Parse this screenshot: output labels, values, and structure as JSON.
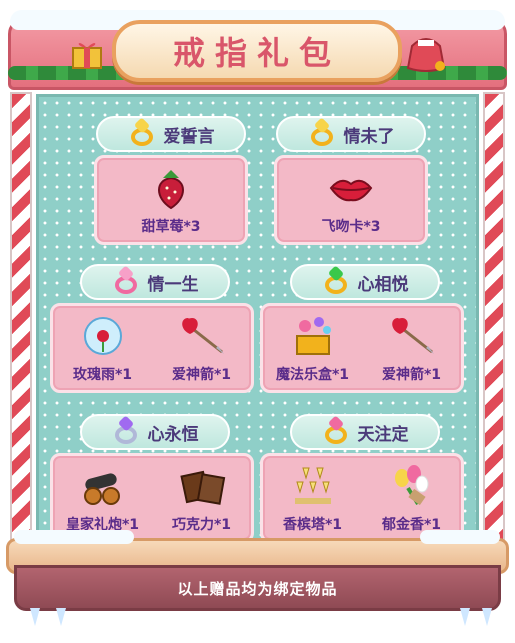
{
  "title": "戒指礼包",
  "footer": "以上赠品均为绑定物品",
  "colors": {
    "label_purple": "#5a2c8a",
    "card_pink": "#f3b9c7",
    "panel_teal": "#8fcfc8",
    "gold": "#f2b21c"
  },
  "packs": [
    {
      "name": "爱誓言",
      "ring_icon": "gold-ring-icon",
      "items": [
        {
          "label": "甜草莓*3",
          "icon": "strawberry-icon"
        }
      ]
    },
    {
      "name": "情未了",
      "ring_icon": "vip-ring-icon",
      "items": [
        {
          "label": "飞吻卡*3",
          "icon": "lips-icon"
        }
      ]
    },
    {
      "name": "情一生",
      "ring_icon": "pink-ring-icon",
      "items": [
        {
          "label": "玫瑰雨*1",
          "icon": "rose-globe-icon"
        },
        {
          "label": "爱神箭*1",
          "icon": "cupid-arrow-icon"
        }
      ]
    },
    {
      "name": "心相悦",
      "ring_icon": "emerald-ring-icon",
      "items": [
        {
          "label": "魔法乐盒*1",
          "icon": "music-box-icon"
        },
        {
          "label": "爱神箭*1",
          "icon": "cupid-arrow-icon"
        }
      ]
    },
    {
      "name": "心永恒",
      "ring_icon": "heart-ring-icon",
      "items": [
        {
          "label": "皇家礼炮*1",
          "icon": "cannon-icon"
        },
        {
          "label": "巧克力*1",
          "icon": "chocolate-icon"
        }
      ]
    },
    {
      "name": "天注定",
      "ring_icon": "vip-heart-ring-icon",
      "items": [
        {
          "label": "香槟塔*1",
          "icon": "champagne-tower-icon"
        },
        {
          "label": "郁金香*1",
          "icon": "tulip-icon"
        }
      ]
    }
  ]
}
